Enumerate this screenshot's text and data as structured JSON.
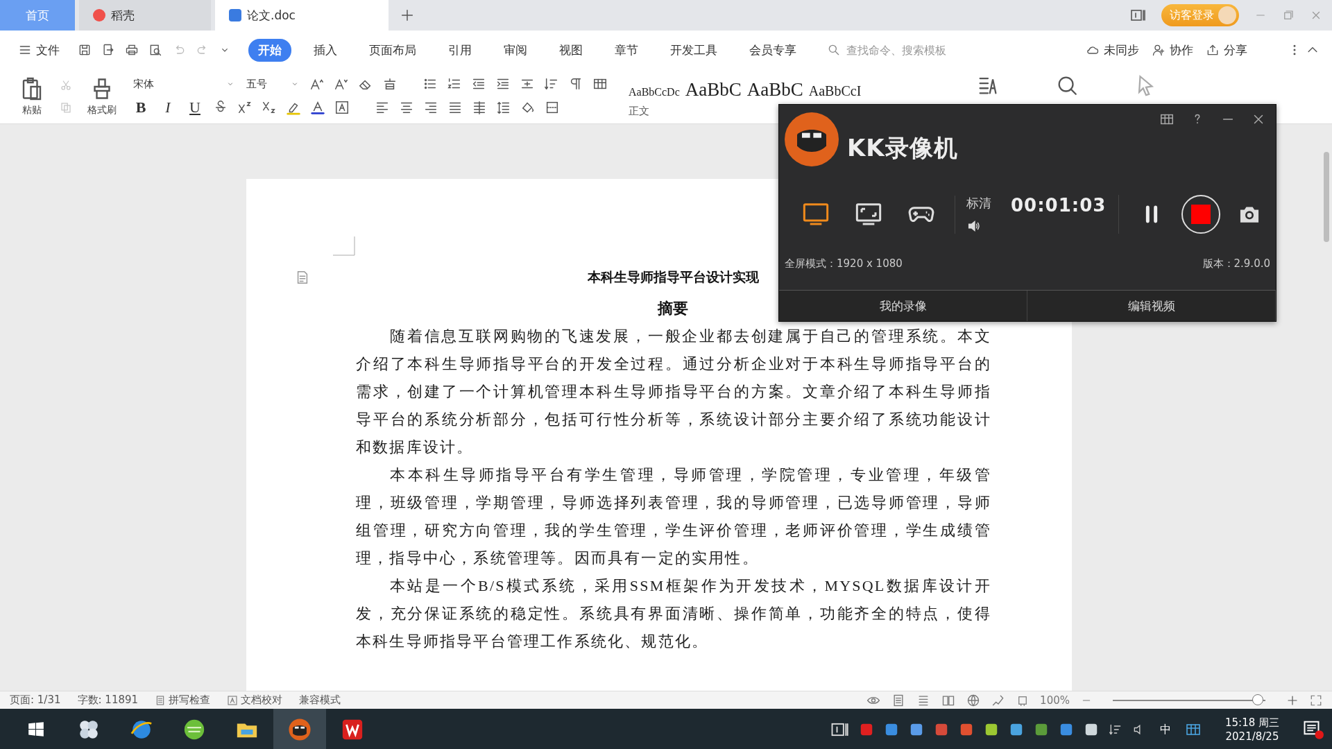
{
  "tabs": [
    {
      "label": "首页",
      "kind": "home",
      "selected": false
    },
    {
      "label": "稻壳",
      "kind": "docer",
      "selected": false
    },
    {
      "label": "论文.doc",
      "kind": "doc",
      "selected": true
    }
  ],
  "account": {
    "label": "访客登录"
  },
  "menu": {
    "file": "文件",
    "tabs": [
      {
        "label": "开始",
        "selected": true
      },
      {
        "label": "插入",
        "selected": false
      },
      {
        "label": "页面布局",
        "selected": false
      },
      {
        "label": "引用",
        "selected": false
      },
      {
        "label": "审阅",
        "selected": false
      },
      {
        "label": "视图",
        "selected": false
      },
      {
        "label": "章节",
        "selected": false
      },
      {
        "label": "开发工具",
        "selected": false
      },
      {
        "label": "会员专享",
        "selected": false
      }
    ],
    "search": {
      "placeholder": "查找命令、搜索模板"
    },
    "actions": [
      "未同步",
      "协作",
      "分享"
    ]
  },
  "ribbon": {
    "paste": "粘贴",
    "format_painter": "格式刷",
    "font": "宋体",
    "size": "五号",
    "format_keys": [
      "B",
      "I",
      "U"
    ],
    "styles": [
      "AaBbCcDc",
      "AaBbC",
      "AaBbC",
      "AaBbCcI"
    ],
    "style_name": "正文"
  },
  "document": {
    "title": "本科生导师指导平台设计实现",
    "heading": "摘要",
    "paragraphs": [
      "随着信息互联网购物的飞速发展，一般企业都去创建属于自己的管理系统。本文介绍了本科生导师指导平台的开发全过程。通过分析企业对于本科生导师指导平台的需求，创建了一个计算机管理本科生导师指导平台的方案。文章介绍了本科生导师指导平台的系统分析部分，包括可行性分析等，系统设计部分主要介绍了系统功能设计和数据库设计。",
      "本本科生导师指导平台有学生管理，导师管理，学院管理，专业管理，年级管理，班级管理，学期管理，导师选择列表管理，我的导师管理，已选导师管理，导师组管理，研究方向管理，我的学生管理，学生评价管理，老师评价管理，学生成绩管理，指导中心，系统管理等。因而具有一定的实用性。",
      "本站是一个B/S模式系统，采用SSM框架作为开发技术，MYSQL数据库设计开发，充分保证系统的稳定性。系统具有界面清晰、操作简单，功能齐全的特点，使得本科生导师指导平台管理工作系统化、规范化。"
    ]
  },
  "recorder": {
    "title": "KK录像机",
    "modes": [
      {
        "kind": "fullscreen",
        "selected": true
      },
      {
        "kind": "region",
        "selected": false
      },
      {
        "kind": "game",
        "selected": false
      }
    ],
    "quality": "标清",
    "time": "00:01:03",
    "mode_info": "全屏模式：1920 x 1080",
    "version": "版本：2.9.0.0",
    "buttons": [
      "我的录像",
      "编辑视频"
    ]
  },
  "status_bar": {
    "page": "页面: 1/31",
    "words": "字数: 11891",
    "items": [
      "拼写检查",
      "文档校对",
      "兼容模式"
    ],
    "zoom": "100%",
    "zoom_slider": {
      "level": 0.95
    }
  },
  "taskbar": {
    "ime": "中",
    "time": "15:18 周三",
    "date": "2021/8/25"
  }
}
